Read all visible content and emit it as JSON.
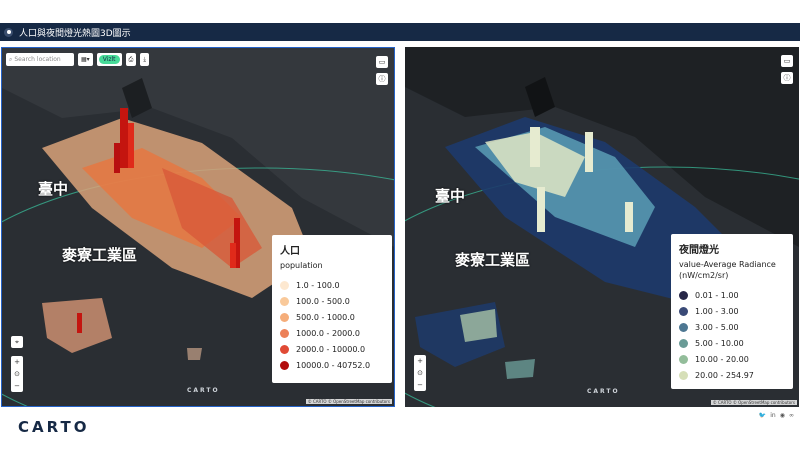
{
  "window": {
    "title": "人口與夜間燈光熱圖3D圖示"
  },
  "left_map": {
    "search_placeholder": "Search location",
    "layers_label": "▾",
    "visualize_label": "Vizlt",
    "label_taichung": "臺中",
    "label_mailiao": "麥寮工業區",
    "legend": {
      "title": "人口",
      "subtitle": "population",
      "items": [
        {
          "label": "1.0 - 100.0",
          "color": "#fde8d0"
        },
        {
          "label": "100.0 - 500.0",
          "color": "#f9c99a"
        },
        {
          "label": "500.0 - 1000.0",
          "color": "#f5ad7a"
        },
        {
          "label": "1000.0 - 2000.0",
          "color": "#ec8158"
        },
        {
          "label": "2000.0 - 10000.0",
          "color": "#e04a35"
        },
        {
          "label": "10000.0 - 40752.0",
          "color": "#b20d0d"
        }
      ]
    },
    "watermark": "CARTO",
    "attribution": "© CARTO  © OpenStreetMap contributors"
  },
  "right_map": {
    "label_taichung": "臺中",
    "label_mailiao": "麥寮工業區",
    "legend": {
      "title": "夜間燈光",
      "subtitle": "value-Average Radiance (nW/cm2/sr)",
      "items": [
        {
          "label": "0.01 - 1.00",
          "color": "#272747"
        },
        {
          "label": "1.00 - 3.00",
          "color": "#3a4a77"
        },
        {
          "label": "3.00 - 5.00",
          "color": "#4d7792"
        },
        {
          "label": "5.00 - 10.00",
          "color": "#6a9b96"
        },
        {
          "label": "10.00 - 20.00",
          "color": "#93bd9a"
        },
        {
          "label": "20.00 - 254.97",
          "color": "#d6dfb8"
        }
      ]
    },
    "watermark": "CARTO",
    "attribution": "© CARTO  © OpenStreetMap contributors"
  },
  "footer": {
    "logo": "CARTO"
  }
}
